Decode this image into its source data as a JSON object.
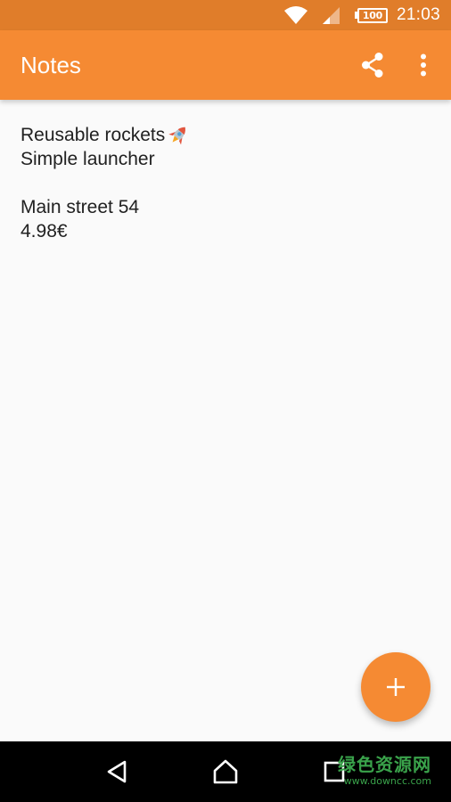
{
  "status_bar": {
    "battery_level": "100",
    "time": "21:03",
    "icons": [
      "wifi-icon",
      "cell-signal-icon",
      "battery-icon"
    ]
  },
  "app_bar": {
    "title": "Notes",
    "actions": [
      "share-icon",
      "more-vert-icon"
    ]
  },
  "note": {
    "lines": [
      {
        "text": "Reusable rockets",
        "emoji": "rocket-icon"
      },
      {
        "text": "Simple launcher"
      },
      {
        "text": ""
      },
      {
        "text": "Main street 54"
      },
      {
        "text": "4.98€"
      }
    ]
  },
  "fab": {
    "icon": "plus-icon"
  },
  "nav_bar": {
    "buttons": [
      "back-icon",
      "home-icon",
      "recents-icon"
    ]
  },
  "watermark": {
    "text": "绿色资源网",
    "url": "www.downcc.com"
  },
  "colors": {
    "status_bar": "#e07d2a",
    "app_bar": "#f58a33",
    "fab": "#f58a33",
    "background": "#fafafa",
    "text": "#212121",
    "nav_bar": "#000000",
    "watermark": "#3aa34b"
  }
}
